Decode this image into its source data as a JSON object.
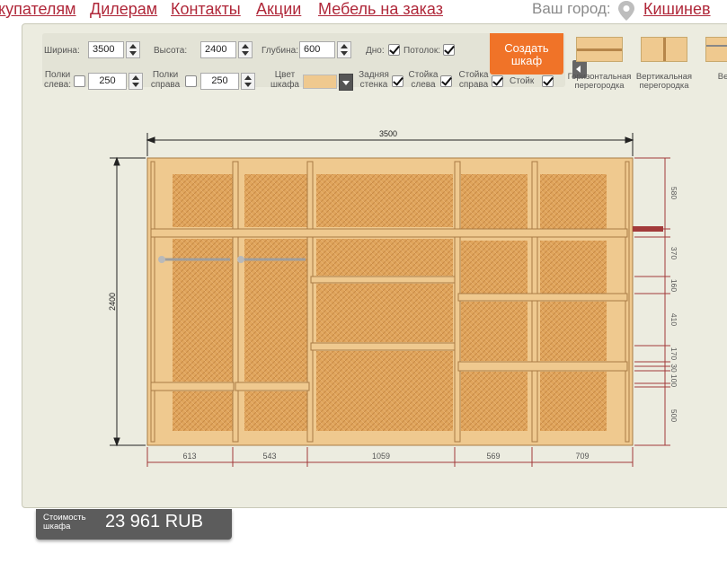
{
  "nav": {
    "items": [
      "купателям",
      "Дилерам",
      "Контакты",
      "Акции",
      "Мебель на заказ"
    ],
    "city_label": "Ваш город:",
    "city": "Кишинев"
  },
  "toolbar": {
    "width_label": "Ширина:",
    "width_value": "3500",
    "height_label": "Высота:",
    "height_value": "2400",
    "depth_label": "Глубина:",
    "depth_value": "600",
    "bottom_label": "Дно:",
    "bottom_checked": true,
    "ceiling_label": "Потолок:",
    "ceiling_checked": true,
    "shelves_left_label_1": "Полки",
    "shelves_left_label_2": "слева:",
    "shelves_left_checked": false,
    "shelves_left_value": "250",
    "shelves_right_label_1": "Полки",
    "shelves_right_label_2": "справа",
    "shelves_right_checked": false,
    "shelves_right_value": "250",
    "color_label_1": "Цвет",
    "color_label_2": "шкафа",
    "color_value": "#efc98f",
    "back_wall_label_1": "Задняя",
    "back_wall_label_2": "стенка",
    "back_wall_checked": true,
    "post_left_label_1": "Стойка",
    "post_left_label_2": "слева",
    "post_left_checked": true,
    "post_right_label_1": "Стойка",
    "post_right_label_2": "справа",
    "post_right_checked": true,
    "post_label": "Стойк",
    "post_checked": true,
    "create_label_1": "Создать",
    "create_label_2": "шкаф"
  },
  "parts": [
    {
      "label_1": "Горизонтальная",
      "label_2": "перегородка",
      "icon": "horizontal-partition-icon"
    },
    {
      "label_1": "Вертикальная",
      "label_2": "перегородка",
      "icon": "vertical-partition-icon"
    },
    {
      "label_1": "Веша",
      "label_2": "",
      "icon": "hanger-rail-icon"
    }
  ],
  "drawing": {
    "overall_width": "3500",
    "overall_height": "2400",
    "column_widths": [
      "613",
      "543",
      "1059",
      "569",
      "709"
    ],
    "right_dims": [
      "580",
      "370",
      "160",
      "410",
      "170",
      "30",
      "100",
      "500"
    ]
  },
  "price": {
    "label_1": "Стоимость",
    "label_2": "шкафа",
    "value": "23 961  RUB"
  },
  "colors": {
    "accent": "#f07328",
    "link": "#b0283a",
    "wood": "#efc98f",
    "back": "#d9a05a",
    "dim": "#a23a3a"
  }
}
